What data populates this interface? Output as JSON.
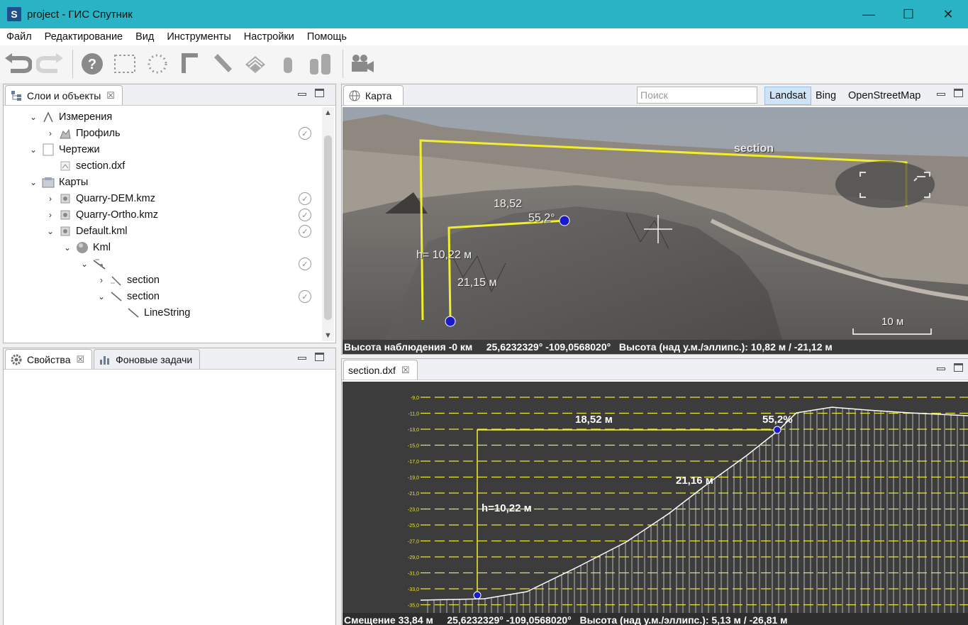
{
  "window": {
    "title": "project - ГИС Спутник",
    "logo_letter": "S",
    "minimize": "—",
    "maximize": "☐",
    "close": "✕"
  },
  "menu": [
    "Файл",
    "Редактирование",
    "Вид",
    "Инструменты",
    "Настройки",
    "Помощь"
  ],
  "toolbar": {
    "icons": [
      "undo-icon",
      "redo-icon",
      "help-icon",
      "rect-select-icon",
      "polygon-select-icon",
      "corner-icon",
      "ruler-icon",
      "area-icon",
      "cylinder-icon",
      "bars-icon",
      "video-camera-icon"
    ]
  },
  "layers_panel": {
    "tab_label": "Слои и объекты",
    "close_glyph": "☒",
    "tree": [
      {
        "label": "Измерения",
        "expanded": true,
        "icon": "measure-icon",
        "checked": false
      },
      {
        "label": "Профиль",
        "expanded": false,
        "icon": "profile-icon",
        "checked": true
      },
      {
        "label": "Чертежи",
        "expanded": true,
        "icon": "document-icon",
        "checked": false
      },
      {
        "label": "section.dxf",
        "icon": "dxf-file-icon",
        "checked": false
      },
      {
        "label": "Карты",
        "expanded": true,
        "icon": "maps-folder-icon",
        "checked": false
      },
      {
        "label": "Quarry-DEM.kmz",
        "expanded": false,
        "icon": "kmz-icon",
        "checked": true
      },
      {
        "label": "Quarry-Ortho.kmz",
        "expanded": false,
        "icon": "kmz-icon",
        "checked": true
      },
      {
        "label": "Default.kml",
        "expanded": true,
        "icon": "kml-icon",
        "checked": true
      },
      {
        "label": "Kml",
        "expanded": true,
        "icon": "globe-icon",
        "checked": false
      },
      {
        "label": "",
        "expanded": true,
        "icon": "folder-lines-icon",
        "checked": true
      },
      {
        "label": "section",
        "expanded": false,
        "icon": "lines-icon",
        "checked": false
      },
      {
        "label": "section",
        "expanded": true,
        "icon": "line-icon",
        "checked": true
      },
      {
        "label": "LineString",
        "icon": "line-icon",
        "checked": false
      }
    ]
  },
  "props_panel": {
    "tab1_label": "Свойства",
    "tab2_label": "Фоновые задачи",
    "close_glyph": "☒"
  },
  "map_panel": {
    "tab_label": "Карта",
    "search_placeholder": "Поиск",
    "layers": [
      "Landsat",
      "Bing",
      "OpenStreetMap"
    ],
    "active_layer": "Landsat",
    "labels": {
      "section": "section",
      "dist_top": "18,52",
      "slope": "55,2°",
      "height": "h= 10,22 м",
      "dist_diag": "21,15 м",
      "scale": "10 м"
    },
    "status": "Высота наблюдения -0 км     25,6232329° -109,0568020°   Высота (над у.м./эллипс.): 10,82 м / -21,12 м"
  },
  "profile_panel": {
    "tab_label": "section.dxf",
    "close_glyph": "☒",
    "labels": {
      "dist_top": "18,52 м",
      "slope": "55,2%",
      "diag": "21,16 м",
      "height": "h=10,22 м"
    },
    "y_ticks": [
      "-9,0",
      "-11,0",
      "-13,0",
      "-15,0",
      "-17,0",
      "-19,0",
      "-21,0",
      "-23,0",
      "-25,0",
      "-27,0",
      "-29,0",
      "-31,0",
      "-33,0",
      "-35,0"
    ],
    "status": "Смещение 33,84 м     25,6232329° -109,0568020°   Высота (над у.м./эллипс.): 5,13 м / -26,81 м"
  },
  "colors": {
    "titlebar": "#2ab3c4",
    "measure_line": "#f2ef2a",
    "point": "#1a1acc",
    "chart_bg": "#3c3c3c"
  }
}
